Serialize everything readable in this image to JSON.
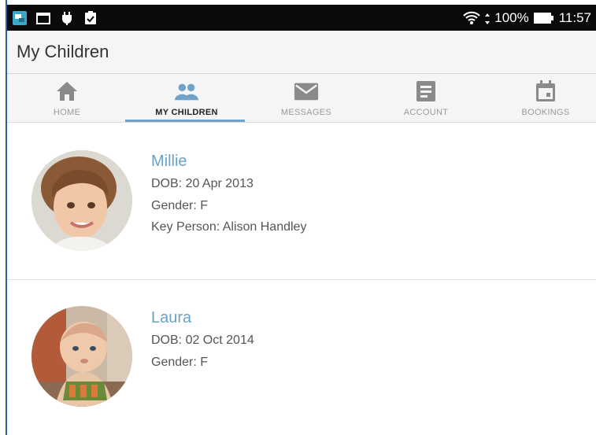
{
  "status_bar": {
    "battery": "100%",
    "time": "11:57",
    "left_icons": [
      "app-notification-icon",
      "folder-icon",
      "android-debug-icon",
      "clipboard-check-icon"
    ]
  },
  "app_bar": {
    "title": "My Children"
  },
  "tabs": [
    {
      "label": "HOME",
      "icon": "home-icon",
      "active": false
    },
    {
      "label": "MY CHILDREN",
      "icon": "people-icon",
      "active": true
    },
    {
      "label": "MESSAGES",
      "icon": "envelope-icon",
      "active": false
    },
    {
      "label": "ACCOUNT",
      "icon": "document-icon",
      "active": false
    },
    {
      "label": "BOOKINGS",
      "icon": "calendar-icon",
      "active": false
    }
  ],
  "children": [
    {
      "name": "Millie",
      "dob": "DOB: 20 Apr 2013",
      "gender": "Gender: F",
      "key_person": "Key Person: Alison Handley"
    },
    {
      "name": "Laura",
      "dob": "DOB: 02 Oct 2014",
      "gender": "Gender: F"
    }
  ],
  "colors": {
    "accent": "#6aa1c8",
    "tab_icon": "#8a8a8a",
    "tab_icon_active": "#6fa3c9",
    "status_bar": "#0a0a0a"
  }
}
